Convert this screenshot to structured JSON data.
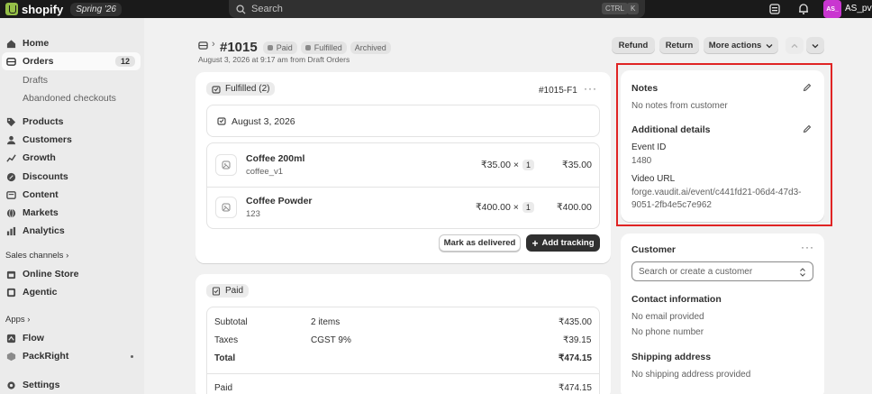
{
  "topbar": {
    "brand": "shopify",
    "edition": "Spring '26",
    "search_placeholder": "Search",
    "kbd_1": "CTRL",
    "kbd_2": "K",
    "avatar_initials": "AS_",
    "store_name": "AS_pvt"
  },
  "sidebar": {
    "home": "Home",
    "orders": "Orders",
    "orders_count": "12",
    "drafts": "Drafts",
    "abandoned": "Abandoned checkouts",
    "products": "Products",
    "customers": "Customers",
    "growth": "Growth",
    "discounts": "Discounts",
    "content": "Content",
    "markets": "Markets",
    "analytics": "Analytics",
    "sales_channels": "Sales channels",
    "online_store": "Online Store",
    "agentic": "Agentic",
    "apps": "Apps",
    "flow": "Flow",
    "packright": "PackRight",
    "settings": "Settings"
  },
  "header": {
    "order_number": "#1015",
    "badge_paid": "Paid",
    "badge_fulfilled": "Fulfilled",
    "badge_archived": "Archived",
    "subtitle": "August 3, 2026 at 9:17 am from Draft Orders",
    "refund": "Refund",
    "return": "Return",
    "more_actions": "More actions"
  },
  "fulfillment": {
    "status": "Fulfilled (2)",
    "id": "#1015-F1",
    "date": "August 3, 2026",
    "items": [
      {
        "name": "Coffee 200ml",
        "sku": "coffee_v1",
        "price": "₹35.00",
        "times": "×",
        "qty": "1",
        "total": "₹35.00"
      },
      {
        "name": "Coffee Powder",
        "sku": "123",
        "price": "₹400.00",
        "times": "×",
        "qty": "1",
        "total": "₹400.00"
      }
    ],
    "mark_delivered": "Mark as delivered",
    "add_tracking": "Add tracking"
  },
  "payment": {
    "status": "Paid",
    "rows": [
      {
        "label": "Subtotal",
        "detail": "2 items",
        "amount": "₹435.00"
      },
      {
        "label": "Taxes",
        "detail": "CGST 9%",
        "amount": "₹39.15"
      },
      {
        "label": "Total",
        "detail": "",
        "amount": "₹474.15"
      }
    ],
    "paid_label": "Paid",
    "paid_amount": "₹474.15"
  },
  "notes": {
    "title": "Notes",
    "empty": "No notes from customer",
    "additional_title": "Additional details",
    "event_label": "Event ID",
    "event_value": "1480",
    "video_label": "Video URL",
    "video_value_1": "forge.vaudit.ai/event/c441fd21-06d4-47d3-",
    "video_value_2": "9051-2fb4e5c7e962"
  },
  "customer": {
    "title": "Customer",
    "search_placeholder": "Search or create a customer",
    "contact_title": "Contact information",
    "no_email": "No email provided",
    "no_phone": "No phone number",
    "shipping_title": "Shipping address",
    "no_shipping": "No shipping address provided"
  },
  "colors": {
    "topbar": "#1a1a1a",
    "brand_green": "#95bf47",
    "highlight": "#e02424",
    "primary_button": "#303030"
  }
}
